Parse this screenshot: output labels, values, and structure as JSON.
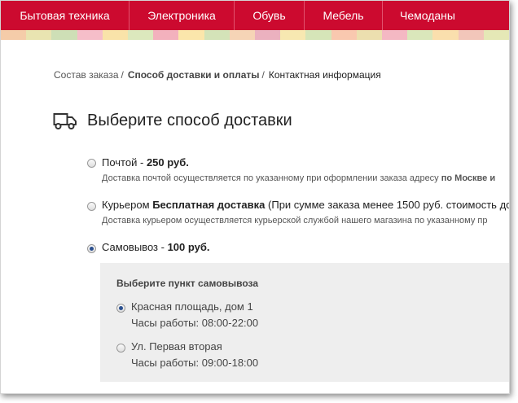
{
  "nav": {
    "items": [
      "Бытовая техника",
      "Электроника",
      "Обувь",
      "Мебель",
      "Чемоданы"
    ]
  },
  "colors": {
    "brand": "#cc0a2f",
    "stripe": [
      "#f4c6a0",
      "#e7e1a8",
      "#c9dcae",
      "#f5b7c3",
      "#f8e0a0",
      "#d8e6b6",
      "#f2a9b6",
      "#fbe3a2",
      "#cfe0b0",
      "#f5cfae",
      "#e9a8b8",
      "#f6e6a8",
      "#d2e2b0",
      "#f8c2a6",
      "#eadba6",
      "#f3b0bd",
      "#d6e4b4",
      "#f9dca4",
      "#f1c0b2",
      "#e2e6ae"
    ]
  },
  "breadcrumb": {
    "step1": "Состав заказа",
    "sep": "/",
    "step2": "Способ доставки и оплаты",
    "step3": "Контактная информация"
  },
  "heading": {
    "icon": "truck-icon",
    "title": "Выберите способ доставки"
  },
  "options": {
    "post": {
      "name": "Почтой",
      "dash": " - ",
      "price": "250 руб.",
      "desc": "Доставка почтой осуществляется по указанному при оформлении заказа адресу",
      "desc_bold": "по Москве и"
    },
    "courier": {
      "name": "Курьером",
      "price": "Бесплатная доставка",
      "note": "(При сумме заказа менее 1500 руб. стоимость до",
      "desc": "Доставка курьером осуществляется курьерской службой нашего магазина по указанному пр"
    },
    "pickup": {
      "name": "Самовывоз",
      "dash": " - ",
      "price": "100 руб.",
      "selected": true
    }
  },
  "pickup_points": {
    "title": "Выберите пункт самовывоза",
    "points": [
      {
        "address": "Красная площадь, дом 1",
        "hours": "Часы работы: 08:00-22:00",
        "selected": true
      },
      {
        "address": "Ул. Первая вторая",
        "hours": "Часы работы: 09:00-18:00",
        "selected": false
      }
    ]
  }
}
